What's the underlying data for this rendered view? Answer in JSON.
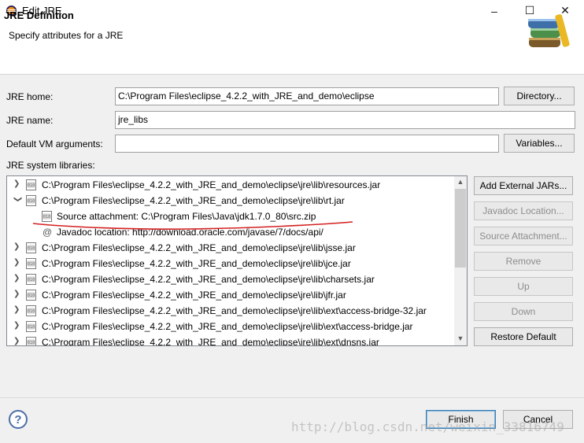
{
  "window": {
    "title": "Edit JRE",
    "minimize_label": "–",
    "maximize_label": "☐",
    "close_label": "✕"
  },
  "header": {
    "title": "JRE Definition",
    "description": "Specify attributes for a JRE"
  },
  "form": {
    "jre_home_label": "JRE home:",
    "jre_home_value": "C:\\Program Files\\eclipse_4.2.2_with_JRE_and_demo\\eclipse",
    "directory_button": "Directory...",
    "jre_name_label": "JRE name:",
    "jre_name_value": "jre_libs",
    "vm_args_label": "Default VM arguments:",
    "vm_args_value": "",
    "variables_button": "Variables...",
    "libraries_label": "JRE system libraries:"
  },
  "libraries": {
    "rows": [
      {
        "text": "C:\\Program Files\\eclipse_4.2.2_with_JRE_and_demo\\eclipse\\jre\\lib\\resources.jar"
      },
      {
        "text_prefix": "C:\\Program Files\\eclipse_4.2.2_with_JRE_and_demo\\eclipse\\jre\\lib\\",
        "text_highlight": "rt.jar"
      },
      {
        "text": "Source attachment: C:\\Program Files\\Java\\jdk1.7.0_80\\src.zip"
      },
      {
        "text": "Javadoc location: http://download.oracle.com/javase/7/docs/api/"
      },
      {
        "text": "C:\\Program Files\\eclipse_4.2.2_with_JRE_and_demo\\eclipse\\jre\\lib\\jsse.jar"
      },
      {
        "text": "C:\\Program Files\\eclipse_4.2.2_with_JRE_and_demo\\eclipse\\jre\\lib\\jce.jar"
      },
      {
        "text": "C:\\Program Files\\eclipse_4.2.2_with_JRE_and_demo\\eclipse\\jre\\lib\\charsets.jar"
      },
      {
        "text": "C:\\Program Files\\eclipse_4.2.2_with_JRE_and_demo\\eclipse\\jre\\lib\\jfr.jar"
      },
      {
        "text": "C:\\Program Files\\eclipse_4.2.2_with_JRE_and_demo\\eclipse\\jre\\lib\\ext\\access-bridge-32.jar"
      },
      {
        "text": "C:\\Program Files\\eclipse_4.2.2_with_JRE_and_demo\\eclipse\\jre\\lib\\ext\\access-bridge.jar"
      },
      {
        "text": "C:\\Program Files\\eclipse_4.2.2_with_JRE_and_demo\\eclipse\\jre\\lib\\ext\\dnsns.jar"
      }
    ],
    "jar_icon_label": "010",
    "javadoc_icon": "@"
  },
  "side_buttons": {
    "add_external_jars": "Add External JARs...",
    "javadoc_location": "Javadoc Location...",
    "source_attachment": "Source Attachment...",
    "remove": "Remove",
    "up": "Up",
    "down": "Down",
    "restore_default": "Restore Default"
  },
  "footer": {
    "help": "?",
    "finish": "Finish",
    "cancel": "Cancel"
  },
  "watermark": "http://blog.csdn.net/weixin_33816749",
  "colors": {
    "highlight": "#ffff00",
    "annotation_underline": "#d42020"
  }
}
